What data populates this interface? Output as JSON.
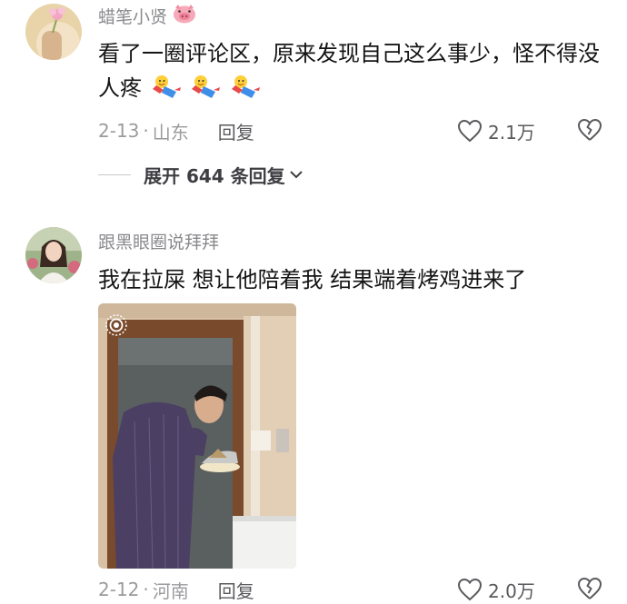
{
  "comments": [
    {
      "username": "蜡笔小贤",
      "username_badge": "pig-face-icon",
      "text": "看了一圈评论区，原来发现自己这么事少，怪不得没人疼",
      "emojis": [
        "dance-emoji-icon",
        "dance-emoji-icon",
        "dance-emoji-icon"
      ],
      "date": "2-13",
      "location": "山东",
      "reply_label": "回复",
      "like_count": "2.1万",
      "expand_label": "展开 644 条回复"
    },
    {
      "username": "跟黑眼圈说拜拜",
      "text": "我在拉屎 想让他陪着我 结果端着烤鸡进来了",
      "date": "2-12",
      "location": "河南",
      "reply_label": "回复",
      "like_count": "2.0万",
      "image_badge": "live-photo-icon"
    }
  ],
  "separator": "·"
}
